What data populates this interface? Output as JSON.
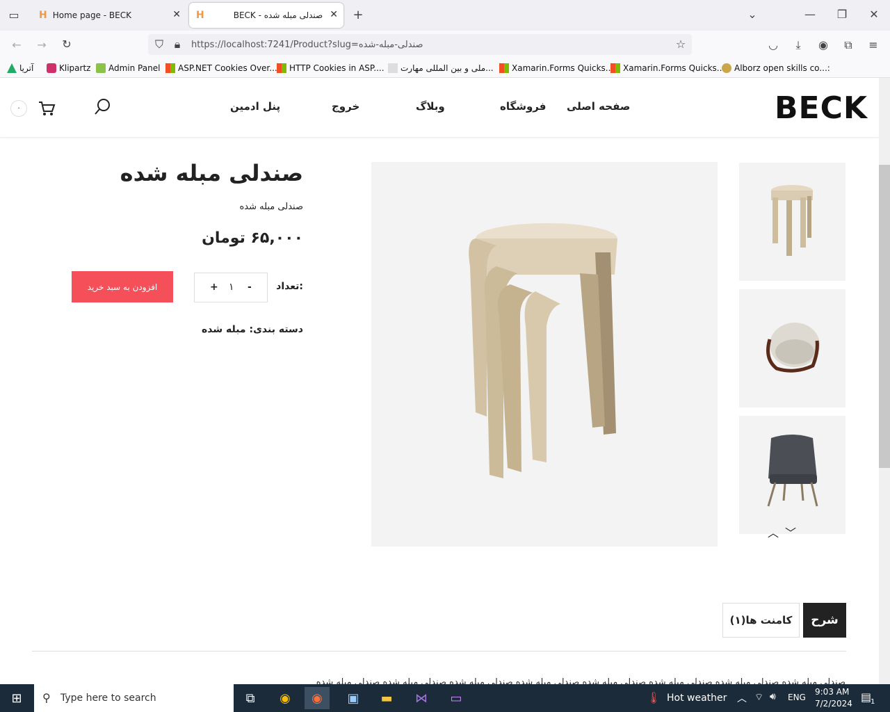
{
  "browser": {
    "tabs": [
      {
        "title": "Home page - BECK",
        "active": false
      },
      {
        "title": "BECK - صندلی مبله شده",
        "active": true
      }
    ],
    "url": "https://localhost:7241/Product?slug=صندلی-مبله-شده",
    "bookmarks": [
      "آتریا",
      "Klipartz",
      "Admin Panel",
      "ASP.NET Cookies Over...",
      "HTTP Cookies in ASP....",
      "ملی و بین المللی مهارت...",
      "Xamarin.Forms Quicks...",
      "Xamarin.Forms Quicks...",
      "Alborz open skills co...:"
    ]
  },
  "site": {
    "logo": "BECK",
    "nav": [
      "صفحه اصلی",
      "فروشگاه",
      "وبلاگ",
      "خروج",
      "پنل ادمین"
    ],
    "cart_count": "۰"
  },
  "product": {
    "title": "صندلی مبله شده",
    "subtitle": "صندلی مبله شده",
    "price": "۶۵,۰۰۰ تومان",
    "qty_label": "تعداد:",
    "qty_value": "۱",
    "qty_minus": "-",
    "qty_plus": "+",
    "add_to_cart": "افزودن به سبد خرید",
    "category": "دسته بندی: مبله شده"
  },
  "tabs": {
    "description": "شرح",
    "comments": "کامنت ها(۱)"
  },
  "description_text": "صندلی مبله شده صندلی مبله شده صندلی مبله شده صندلی مبله شده صندلی مبله شده صندلی مبله شده صندلی مبله شده صندلی مبله شده",
  "taskbar": {
    "search_placeholder": "Type here to search",
    "weather": "Hot weather",
    "lang": "ENG",
    "time": "9:03 AM",
    "date": "7/2/2024",
    "notifications": "1"
  },
  "colors": {
    "accent": "#f5505a",
    "dark": "#222222"
  }
}
